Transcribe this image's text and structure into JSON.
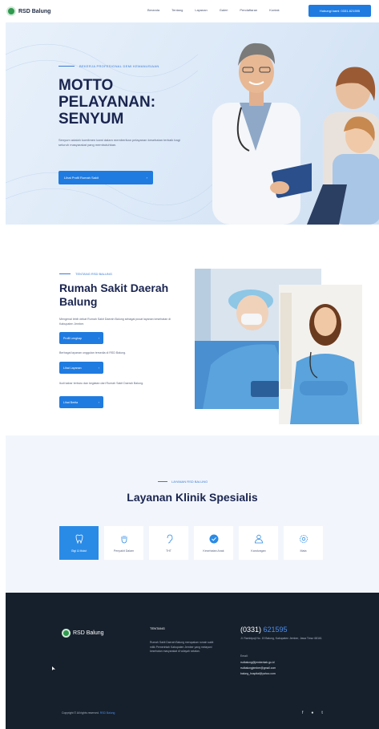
{
  "nav": {
    "brand": "RSD Balung",
    "links": [
      "Beranda",
      "Tentang",
      "Layanan",
      "Galeri",
      "Pendaftaran",
      "Kontak"
    ],
    "cta": "Hubungi kami: 0331-621595",
    "brand_color": "#2f9a4e",
    "accent_color": "#1f7be0"
  },
  "hero": {
    "kicker": "BEKERJA PROFESIONAL DEMI KEMANUSIAAN",
    "title_line1": "MOTTO",
    "title_line2": "PELAYANAN:",
    "title_line3": "SENYUM",
    "description": "Senyum adalah komitmen kami dalam memberikan pelayanan kesehatan terbaik bagi seluruh masyarakat yang membutuhkan.",
    "button": "Lihat Profil Rumah Sakit",
    "button_icon": "chevron-right-icon"
  },
  "about": {
    "kicker": "TENTANG RSD BALUNG",
    "title_line1": "Rumah Sakit Daerah",
    "title_line2": "Balung",
    "p1": "Mengenal lebih dekat Rumah Sakit Daerah Balung sebagai pusat layanan kesehatan di Kabupaten Jember.",
    "btn1": "Profil Lengkap",
    "p2": "Berbagai layanan unggulan tersedia di RSD Balung.",
    "btn2": "Lihat Layanan",
    "p3": "Ikuti kabar terbaru dan kegiatan dari Rumah Sakit Daerah Balung.",
    "btn3": "Lihat Berita"
  },
  "services": {
    "kicker": "LAYANAN RSD BALUNG",
    "title": "Layanan Klinik Spesialis",
    "cards": [
      {
        "label": "Gigi & Mulut",
        "icon": "tooth-icon",
        "active": true
      },
      {
        "label": "Penyakit Dalam",
        "icon": "hand-icon",
        "active": false
      },
      {
        "label": "THT",
        "icon": "ear-icon",
        "active": false
      },
      {
        "label": "Kesehatan Anak",
        "icon": "check-badge-icon",
        "active": false
      },
      {
        "label": "Kandungan",
        "icon": "person-icon",
        "active": false
      },
      {
        "label": "Mata",
        "icon": "eye-gear-icon",
        "active": false
      }
    ]
  },
  "footer": {
    "brand": "RSD Balung",
    "about_title": "TENTANG",
    "about_text": "Rumah Sakit Daerah Balung merupakan rumah sakit milik Pemerintah Kabupaten Jember yang melayani kesehatan masyarakat di wilayah selatan.",
    "phone_prefix": "(0331)",
    "phone_number": "621595",
    "address": "Jl. Rambipuji No. 19 Balung, Kabupaten Jember, Jawa Timur 68161",
    "email_label": "Email:",
    "emails": [
      "rsdbalung@jemberkab.go.id",
      "rsdbalungjember@gmail.com",
      "balung_hospital@yahoo.com"
    ],
    "copyright": "Copyright © All rights reserved.",
    "copyright_link": "RSD Balung",
    "social": [
      "f",
      "●",
      "t"
    ]
  }
}
